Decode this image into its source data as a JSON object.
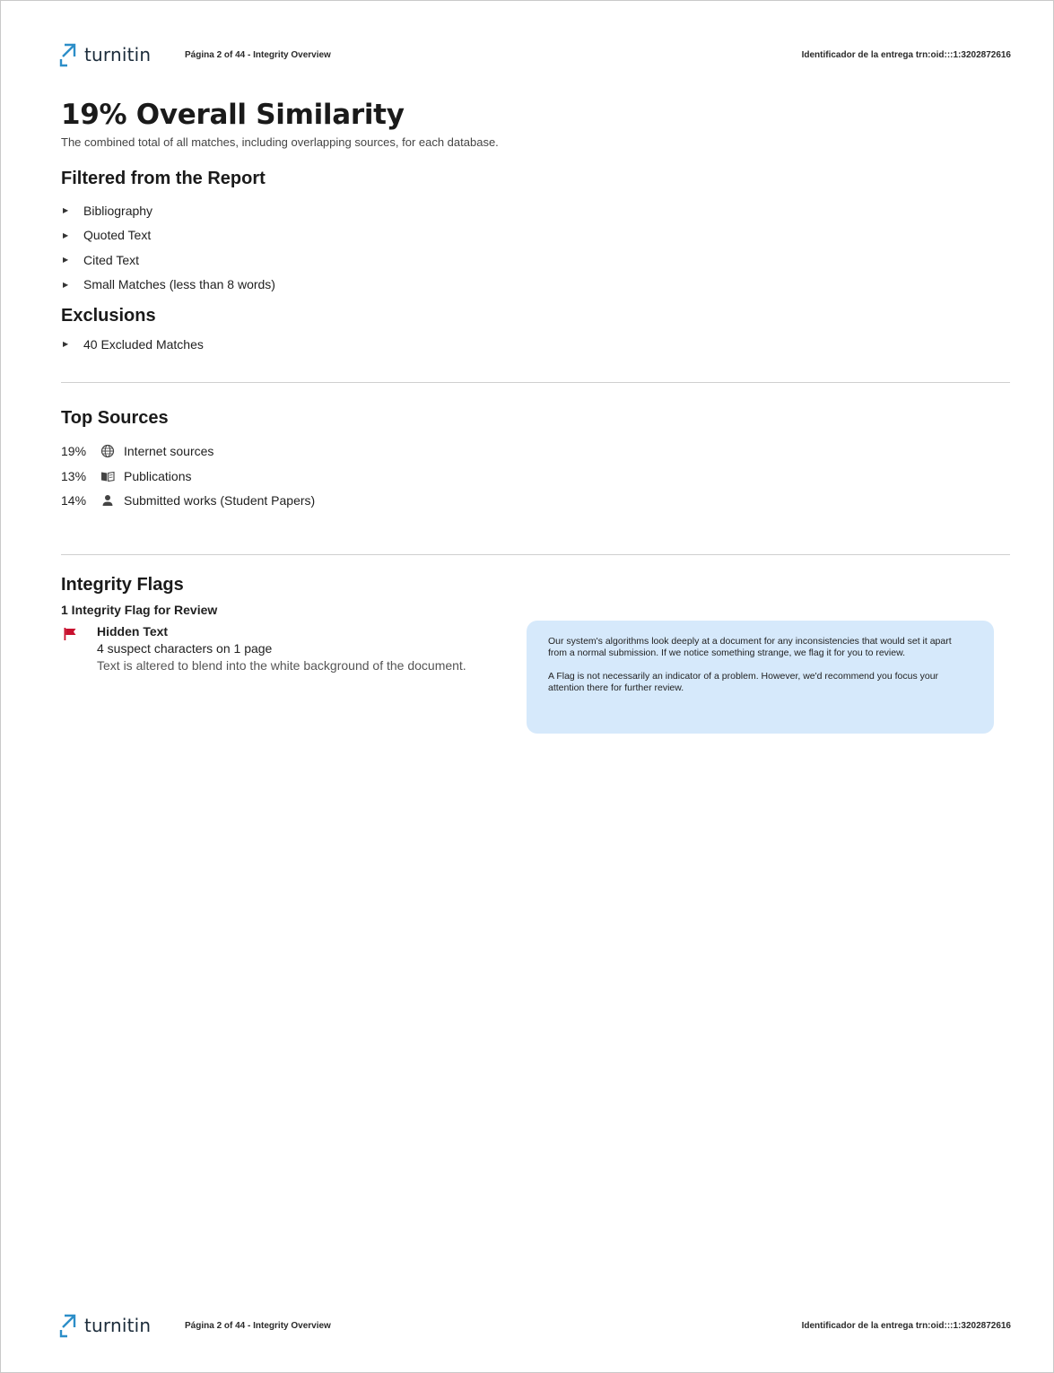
{
  "header": {
    "logo_text": "turnitin",
    "page_info": "Página 2 of 44 - Integrity Overview",
    "submission_id": "Identificador de la entrega trn:oid:::1:3202872616"
  },
  "footer": {
    "logo_text": "turnitin",
    "page_info": "Página 2 of 44 - Integrity Overview",
    "submission_id": "Identificador de la entrega trn:oid:::1:3202872616"
  },
  "overview": {
    "title": "19% Overall Similarity",
    "subtitle": "The combined total of all matches, including overlapping sources, for each database."
  },
  "filtered": {
    "heading": "Filtered from the Report",
    "items": [
      "Bibliography",
      "Quoted Text",
      "Cited Text",
      "Small Matches (less than 8 words)"
    ]
  },
  "exclusions": {
    "heading": "Exclusions",
    "items": [
      "40 Excluded Matches"
    ]
  },
  "top_sources": {
    "heading": "Top Sources",
    "items": [
      {
        "percent": "19%",
        "icon": "globe-icon",
        "label": "Internet sources"
      },
      {
        "percent": "13%",
        "icon": "book-icon",
        "label": "Publications"
      },
      {
        "percent": "14%",
        "icon": "person-icon",
        "label": "Submitted works (Student Papers)"
      }
    ]
  },
  "integrity_flags": {
    "heading": "Integrity Flags",
    "subheading": "1 Integrity Flag for Review",
    "flag": {
      "icon": "flag-icon",
      "color": "#c8102e",
      "title": "Hidden Text",
      "count": "4 suspect characters on 1 page",
      "description": "Text is altered to blend into the white background of the document."
    },
    "info_box": {
      "paragraph_1": "Our system's algorithms look deeply at a document for any inconsistencies that would set it apart from a normal submission. If we notice something strange, we flag it for you to review.",
      "paragraph_2": "A Flag is not necessarily an indicator of a problem. However, we'd recommend you focus your attention there for further review."
    }
  }
}
